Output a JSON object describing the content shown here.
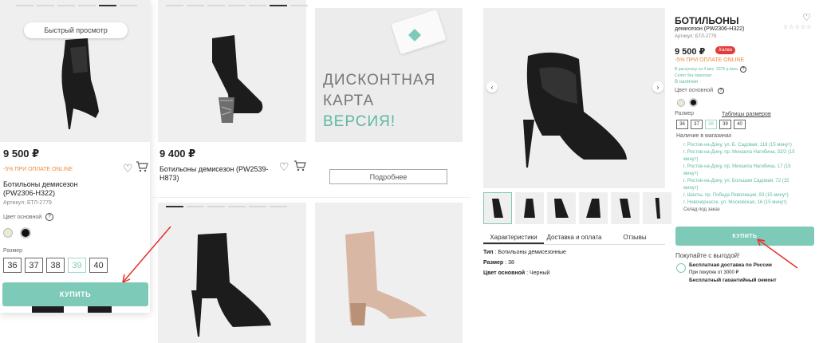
{
  "card1": {
    "quick_view": "Быстрый просмотр",
    "price": "9 500 ₽",
    "promo": "-5% ПРИ ОПЛАТЕ ONLINE",
    "name": "Ботильоны демисезон (PW2306-H322)",
    "article": "Артикул: БТЛ-2779",
    "color_label": "Цвет основной",
    "size_label": "Размер",
    "sizes": [
      "36",
      "37",
      "38",
      "39",
      "40"
    ],
    "buy": "КУПИТЬ"
  },
  "card2": {
    "price": "9 400 ₽",
    "name": "Ботильоны демисезон (PW2539-H873)"
  },
  "promo_card": {
    "line1": "ДИСКОНТНАЯ",
    "line2": "КАРТА",
    "line3": "ВЕРСИЯ!",
    "more": "Подробнее"
  },
  "product": {
    "title": "БОТИЛЬОНЫ",
    "subtitle": "демисезон (PW2306-H322)",
    "article": "Артикул: БТЛ-2779",
    "price": "9 500 ₽",
    "badge": "Халва",
    "promo": "-5% ПРИ ОПЛАТЕ ONLINE",
    "installment1": "В рассрочку на 4 мес. 2375 р./мес.",
    "installment2": "Сплит без переплат",
    "in_stock": "В наличии",
    "color_label": "Цвет основной",
    "size_label": "Размер",
    "size_table": "Таблицы размеров",
    "sizes": [
      "36",
      "37",
      "38",
      "39",
      "40"
    ],
    "stores_label": "Наличие в магазинах",
    "stores": [
      "г. Ростов-на-Дону, ул. Б. Садовая, 118 (15 минут)",
      "г. Ростов-на-Дону, пр. Михаила Нагибина, 32/2 (15",
      "минут)",
      "г. Ростов-на-Дону, пр. Михаила Нагибина, 17 (15",
      "минут)",
      "г. Ростов-на-Дону, ул. Большая Садовая, 72 (15",
      "минут)",
      "г. Шахты, пр. Победа Революции, 93 (15 минут)",
      "г. Новочеркасск, ул. Московская, 16 (15 минут)"
    ],
    "warehouse": "Склад под заказ",
    "buy": "КУПИТЬ",
    "benefits_title": "Покупайте с выгодой!",
    "benefit1": "Бесплатная доставка по России",
    "benefit1_sub": "При покупке от 3000 ₽",
    "benefit2": "Бесплатный гарантийный ремонт",
    "tabs": [
      "Характеристики",
      "Доставка и оплата",
      "Отзывы"
    ],
    "specs": [
      {
        "k": "Тип",
        "v": "Ботильоны демисезонные"
      },
      {
        "k": "Размер",
        "v": "38"
      },
      {
        "k": "Цвет основной",
        "v": "Черный"
      }
    ]
  }
}
